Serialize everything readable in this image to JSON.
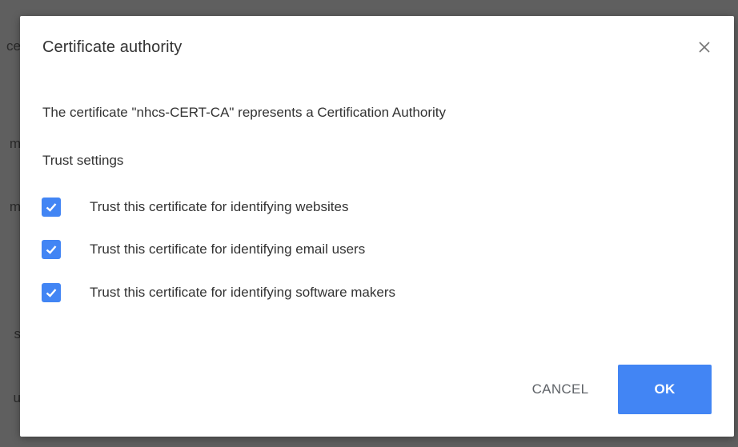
{
  "background": {
    "fragments": [
      "ce",
      "m",
      "m",
      "s",
      "u"
    ]
  },
  "dialog": {
    "title": "Certificate authority",
    "close_icon": "close-icon",
    "description": "The certificate \"nhcs-CERT-CA\" represents a Certification Authority",
    "section_label": "Trust settings",
    "options": [
      {
        "label": "Trust this certificate for identifying websites",
        "checked": true
      },
      {
        "label": "Trust this certificate for identifying email users",
        "checked": true
      },
      {
        "label": "Trust this certificate for identifying software makers",
        "checked": true
      }
    ],
    "cancel_label": "CANCEL",
    "ok_label": "OK"
  },
  "colors": {
    "accent": "#4285f4",
    "text": "#333333",
    "backdrop": "#5f5f5f"
  }
}
